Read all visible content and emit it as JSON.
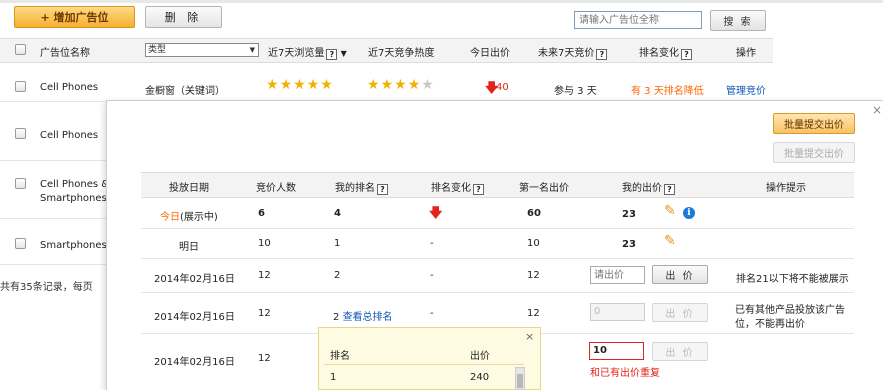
{
  "toolbar": {
    "add_label": "+ 增加广告位",
    "delete_label": "删 除",
    "search_placeholder": "请输入广告位全称",
    "search_label": "搜 索"
  },
  "table": {
    "headers": {
      "name": "广告位名称",
      "type": "类型",
      "views7": "近7天浏览量",
      "heat7": "近7天竞争热度",
      "today_bid": "今日出价",
      "future7": "未来7天竞价",
      "rank_change": "排名变化",
      "action": "操作"
    },
    "rows": [
      {
        "name": "Cell Phones",
        "type": "金橱窗（关键词）",
        "views_stars": 5,
        "heat_stars": 4,
        "today_bid": "40",
        "future7": "参与 3 天",
        "rank_change": "有 3 天排名降低",
        "action": "管理竞价"
      },
      {
        "name": "Cell Phones"
      },
      {
        "name_line1": "Cell Phones &",
        "name_line2": "Smartphones"
      },
      {
        "name": "Smartphones"
      }
    ],
    "footer": "共有35条记录，每页"
  },
  "panel": {
    "batch_submit": "批量提交出价",
    "batch_submit_disabled": "批量提交出价",
    "headers": {
      "date": "投放日期",
      "bidders": "竞价人数",
      "my_rank": "我的排名",
      "rank_change": "排名变化",
      "top_bid": "第一名出价",
      "my_bid": "我的出价",
      "tip": "操作提示"
    },
    "rows": [
      {
        "date_prefix": "今日",
        "date_suffix": "(展示中)",
        "bidders": "6",
        "my_rank": "4",
        "top_bid": "60",
        "my_bid": "23"
      },
      {
        "date": "明日",
        "bidders": "10",
        "my_rank": "1",
        "rank_change": "-",
        "top_bid": "10",
        "my_bid": "23"
      },
      {
        "date": "2014年02月16日",
        "bidders": "12",
        "my_rank": "2",
        "rank_change": "-",
        "top_bid": "12",
        "bid_placeholder": "请出价",
        "bid_button": "出 价",
        "tip": "排名21以下将不能被展示"
      },
      {
        "date": "2014年02月16日",
        "bidders": "12",
        "my_rank": "2",
        "rank_link": "查看总排名",
        "rank_change": "-",
        "top_bid": "12",
        "bid_value": "0",
        "bid_button": "出 价",
        "tip_line1": "已有其他产品投放该广告",
        "tip_line2": "位，不能再出价"
      },
      {
        "date": "2014年02月16日",
        "bidders": "12",
        "top_bid": "12",
        "bid_value": "10",
        "bid_button": "出 价",
        "error": "和已有出价重复"
      }
    ]
  },
  "popup": {
    "col_rank": "排名",
    "col_bid": "出价",
    "rows": [
      {
        "rank": "1",
        "bid": "240"
      }
    ]
  },
  "icons": {
    "question": "?",
    "down_arrow": "🡇",
    "pencil": "✎",
    "info": "i",
    "close": "×"
  },
  "colors": {
    "accent_orange": "#f5b02f",
    "red": "#e2231a",
    "link_blue": "#0f57b8",
    "star": "#f2b100"
  }
}
